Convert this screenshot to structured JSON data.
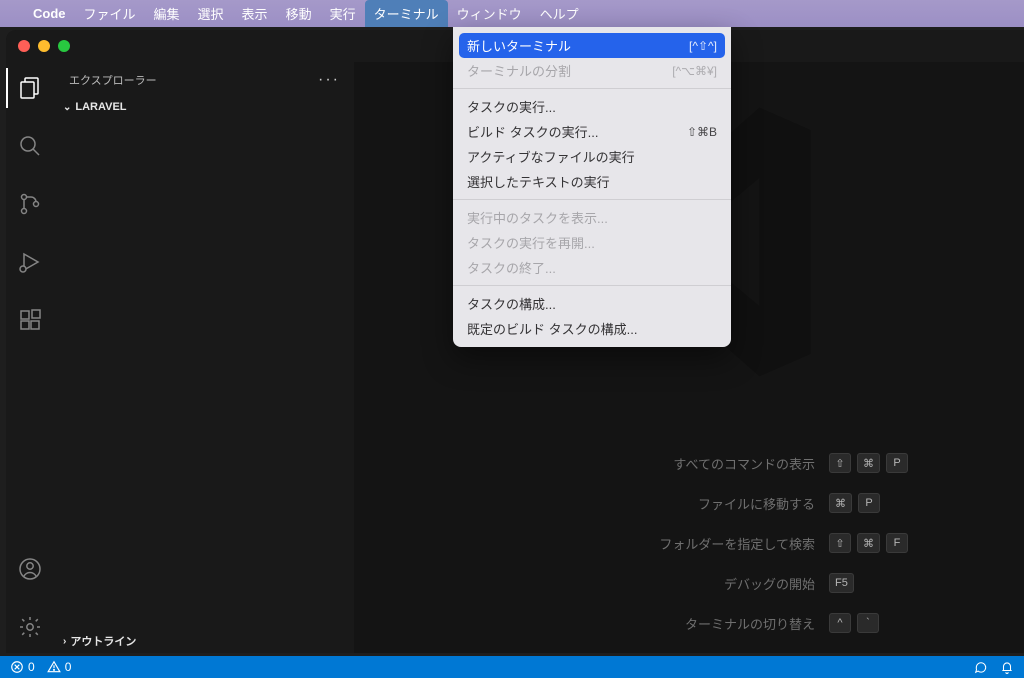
{
  "menubar": {
    "app_icon": "apple-logo",
    "items": [
      {
        "label": "Code",
        "app": true
      },
      {
        "label": "ファイル"
      },
      {
        "label": "編集"
      },
      {
        "label": "選択"
      },
      {
        "label": "表示"
      },
      {
        "label": "移動"
      },
      {
        "label": "実行"
      },
      {
        "label": "ターミナル",
        "active": true
      },
      {
        "label": "ウィンドウ"
      },
      {
        "label": "ヘルプ"
      }
    ]
  },
  "dropdown": {
    "items": [
      {
        "label": "新しいターミナル",
        "shortcut": "[^⇧^]",
        "highlight": true
      },
      {
        "label": "ターミナルの分割",
        "shortcut": "[^⌥⌘¥]",
        "disabled": true
      },
      {
        "sep": true
      },
      {
        "label": "タスクの実行..."
      },
      {
        "label": "ビルド タスクの実行...",
        "shortcut": "⇧⌘B"
      },
      {
        "label": "アクティブなファイルの実行"
      },
      {
        "label": "選択したテキストの実行"
      },
      {
        "sep": true
      },
      {
        "label": "実行中のタスクを表示...",
        "disabled": true
      },
      {
        "label": "タスクの実行を再開...",
        "disabled": true
      },
      {
        "label": "タスクの終了...",
        "disabled": true
      },
      {
        "sep": true
      },
      {
        "label": "タスクの構成..."
      },
      {
        "label": "既定のビルド タスクの構成..."
      }
    ]
  },
  "sidebar": {
    "explorer_title": "エクスプローラー",
    "dots": "···",
    "project_name": "LARAVEL",
    "outline_title": "アウトライン"
  },
  "shortcuts": [
    {
      "label": "すべてのコマンドの表示",
      "keys": [
        "⇧",
        "⌘",
        "P"
      ]
    },
    {
      "label": "ファイルに移動する",
      "keys": [
        "⌘",
        "P"
      ]
    },
    {
      "label": "フォルダーを指定して検索",
      "keys": [
        "⇧",
        "⌘",
        "F"
      ]
    },
    {
      "label": "デバッグの開始",
      "keys": [
        "F5"
      ]
    },
    {
      "label": "ターミナルの切り替え",
      "keys": [
        "^",
        "`"
      ]
    }
  ],
  "statusbar": {
    "errors": "0",
    "warnings": "0"
  }
}
